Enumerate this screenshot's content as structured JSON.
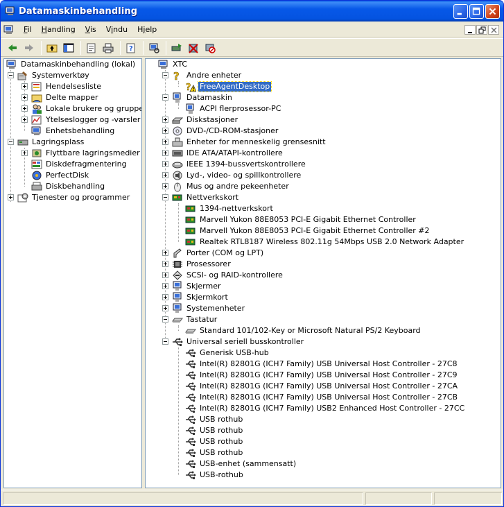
{
  "window": {
    "title": "Datamaskinbehandling"
  },
  "menu": {
    "items": [
      {
        "label": "Fil",
        "mnemonic": "F"
      },
      {
        "label": "Handling",
        "mnemonic": "H"
      },
      {
        "label": "Vis",
        "mnemonic": "V"
      },
      {
        "label": "Vindu",
        "mnemonic": "i"
      },
      {
        "label": "Hjelp",
        "mnemonic": "j"
      }
    ]
  },
  "toolbar": {
    "icons": [
      "back-arrow-icon",
      "forward-arrow-icon",
      "up-folder-icon",
      "show-hide-tree-icon",
      "properties-icon",
      "print-icon",
      "help-icon",
      "scan-hardware-icon",
      "update-driver-icon",
      "uninstall-icon",
      "disable-icon"
    ]
  },
  "left_tree": {
    "root": "Datamaskinbehandling (lokal)",
    "items": [
      {
        "label": "Systemverktøy"
      },
      {
        "label": "Hendelsesliste"
      },
      {
        "label": "Delte mapper"
      },
      {
        "label": "Lokale brukere og grupper"
      },
      {
        "label": "Ytelseslogger og -varsler"
      },
      {
        "label": "Enhetsbehandling"
      },
      {
        "label": "Lagringsplass"
      },
      {
        "label": "Flyttbare lagringsmedier"
      },
      {
        "label": "Diskdefragmentering"
      },
      {
        "label": "PerfectDisk"
      },
      {
        "label": "Diskbehandling"
      },
      {
        "label": "Tjenester og programmer"
      }
    ]
  },
  "device_tree": {
    "root": "XTC",
    "items": [
      {
        "label": "Andre enheter"
      },
      {
        "label": "FreeAgentDesktop"
      },
      {
        "label": "Datamaskin"
      },
      {
        "label": "ACPI flerprosessor-PC"
      },
      {
        "label": "Diskstasjoner"
      },
      {
        "label": "DVD-/CD-ROM-stasjoner"
      },
      {
        "label": "Enheter for menneskelig grensesnitt"
      },
      {
        "label": "IDE ATA/ATAPI-kontrollere"
      },
      {
        "label": "IEEE 1394-bussvertskontrollere"
      },
      {
        "label": "Lyd-, video- og spillkontrollere"
      },
      {
        "label": "Mus og andre pekeenheter"
      },
      {
        "label": "Nettverkskort"
      },
      {
        "label": "1394-nettverkskort"
      },
      {
        "label": "Marvell Yukon 88E8053 PCI-E Gigabit Ethernet Controller"
      },
      {
        "label": "Marvell Yukon 88E8053 PCI-E Gigabit Ethernet Controller #2"
      },
      {
        "label": "Realtek RTL8187 Wireless 802.11g 54Mbps USB 2.0 Network Adapter"
      },
      {
        "label": "Porter (COM og LPT)"
      },
      {
        "label": "Prosessorer"
      },
      {
        "label": "SCSI- og RAID-kontrollere"
      },
      {
        "label": "Skjermer"
      },
      {
        "label": "Skjermkort"
      },
      {
        "label": "Systemenheter"
      },
      {
        "label": "Tastatur"
      },
      {
        "label": "Standard 101/102-Key or Microsoft Natural PS/2 Keyboard"
      },
      {
        "label": "Universal seriell busskontroller"
      },
      {
        "label": "Generisk USB-hub"
      },
      {
        "label": "Intel(R) 82801G (ICH7 Family) USB Universal Host Controller - 27C8"
      },
      {
        "label": "Intel(R) 82801G (ICH7 Family) USB Universal Host Controller - 27C9"
      },
      {
        "label": "Intel(R) 82801G (ICH7 Family) USB Universal Host Controller - 27CA"
      },
      {
        "label": "Intel(R) 82801G (ICH7 Family) USB Universal Host Controller - 27CB"
      },
      {
        "label": "Intel(R) 82801G (ICH7 Family) USB2 Enhanced Host Controller - 27CC"
      },
      {
        "label": "USB rothub"
      },
      {
        "label": "USB rothub"
      },
      {
        "label": "USB rothub"
      },
      {
        "label": "USB rothub"
      },
      {
        "label": "USB-enhet (sammensatt)"
      },
      {
        "label": "USB-rothub"
      }
    ]
  },
  "colors": {
    "titlebar": "#0453e0",
    "selection": "#316ac5",
    "chrome": "#ece9d8"
  }
}
